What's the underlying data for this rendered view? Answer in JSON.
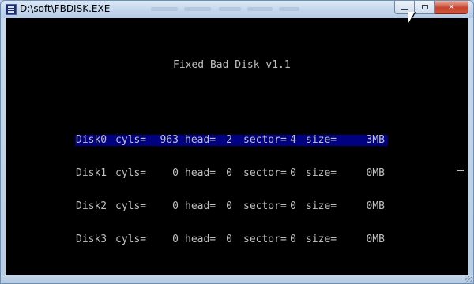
{
  "window": {
    "title": "D:\\soft\\FBDISK.EXE",
    "controls": {
      "minimize_icon": "minimize-icon",
      "maximize_icon": "maximize-icon",
      "close_icon": "close-icon",
      "close_label": "✕"
    }
  },
  "console": {
    "heading": "Fixed Bad Disk v1.1",
    "labels": {
      "cyls": "cyls=",
      "head": "head=",
      "sector": "sector=",
      "size": "size="
    },
    "disks": [
      {
        "name": "Disk0",
        "cyls": "963",
        "head": "2",
        "sector": "4",
        "size": "3MB",
        "selected": true
      },
      {
        "name": "Disk1",
        "cyls": "0",
        "head": "0",
        "sector": "0",
        "size": "0MB",
        "selected": false
      },
      {
        "name": "Disk2",
        "cyls": "0",
        "head": "0",
        "sector": "0",
        "size": "0MB",
        "selected": false
      },
      {
        "name": "Disk3",
        "cyls": "0",
        "head": "0",
        "sector": "0",
        "size": "0MB",
        "selected": false
      }
    ],
    "colors": {
      "background": "#000000",
      "text": "#c0c0c0",
      "selection": "#000080"
    }
  }
}
